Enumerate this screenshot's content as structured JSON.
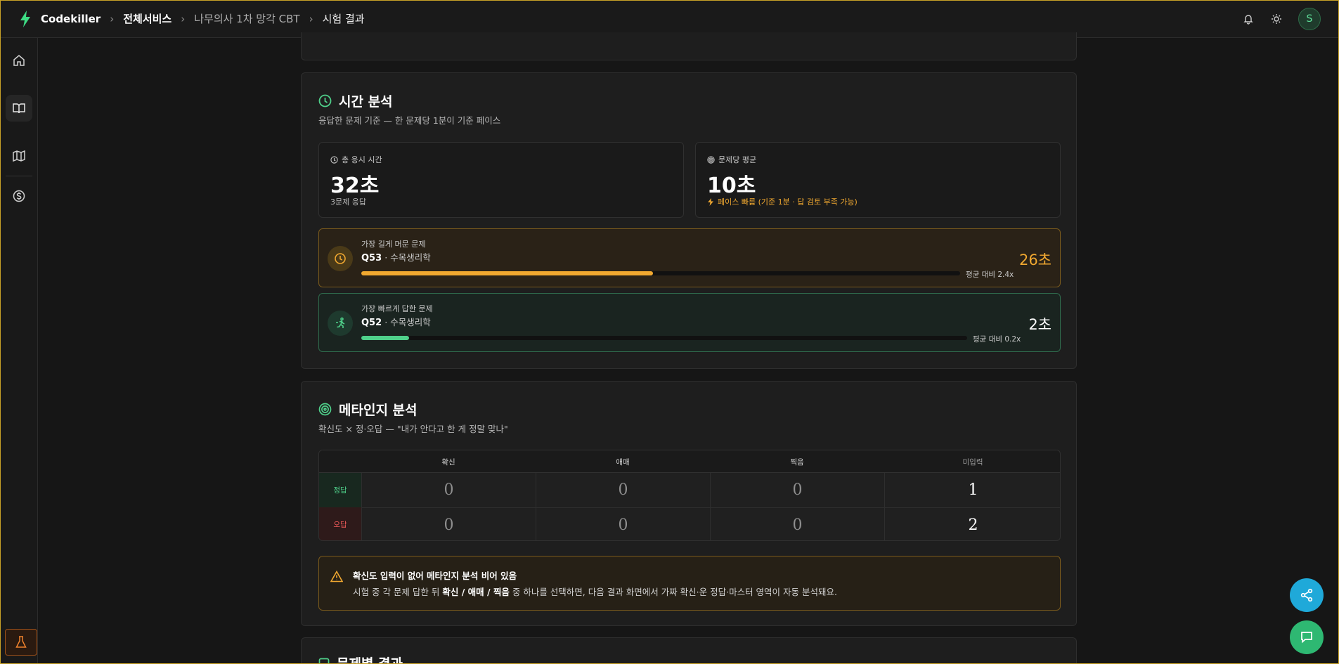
{
  "header": {
    "brand": "Codekiller",
    "breadcrumbs": [
      "전체서비스",
      "나무의사 1차 망각 CBT",
      "시험 결과"
    ],
    "avatar_initial": "S"
  },
  "time_analysis": {
    "title": "시간 분석",
    "subtitle": "응답한 문제 기준 — 한 문제당 1분이 기준 페이스",
    "total": {
      "label": "총 응시 시간",
      "value": "32초",
      "note": "3문제 응답"
    },
    "average": {
      "label": "문제당 평균",
      "value": "10초",
      "note": "페이스 빠름 (기준 1분 · 답 검토 부족 가능)"
    },
    "slowest": {
      "kicker": "가장 길게 머문 문제",
      "id": "Q53",
      "subject": "· 수목생리학",
      "ratio_text": "평균 대비 2.4x",
      "time": "26초",
      "fill_fraction": 0.487
    },
    "fastest": {
      "kicker": "가장 빠르게 답한 문제",
      "id": "Q52",
      "subject": "· 수목생리학",
      "ratio_text": "평균 대비 0.2x",
      "time": "2초",
      "fill_fraction": 0.079
    }
  },
  "metacognition": {
    "title": "메타인지 분석",
    "subtitle": "확신도 × 정·오답 — \"내가 안다고 한 게 정말 맞나\"",
    "columns": [
      "확신",
      "애매",
      "찍음",
      "미입력"
    ],
    "rows": [
      {
        "label": "정답",
        "values": [
          "0",
          "0",
          "0",
          "1"
        ]
      },
      {
        "label": "오답",
        "values": [
          "0",
          "0",
          "0",
          "2"
        ]
      }
    ],
    "alert": {
      "title": "확신도 입력이 없어 메타인지 분석 비어 있음",
      "body_pre": "시험 중 각 문제 답한 뒤 ",
      "body_bold": "확신 / 애매 / 찍음",
      "body_post": " 중 하나를 선택하면, 다음 결과 화면에서 가짜 확신·운 정답·마스터 영역이 자동 분석돼요."
    }
  },
  "next_section": {
    "title": "문제별 결과"
  },
  "colors": {
    "accent_green": "#4fd08a",
    "warn_orange": "#f0a830",
    "error_red": "#ef5a5a",
    "share_blue": "#1fa9d9"
  }
}
